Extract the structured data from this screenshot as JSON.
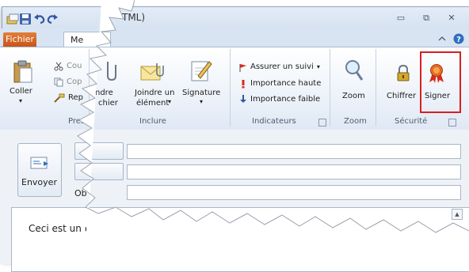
{
  "window": {
    "title_fragment": "TML)",
    "minimize_glyph": "▭",
    "restore_glyph": "⧉",
    "close_glyph": "✕"
  },
  "tabs": {
    "file": "Fichier",
    "active_fragment": "Me"
  },
  "ribbon": {
    "clipboard": {
      "paste": "Coller",
      "cut": "Cou",
      "copy": "Cop",
      "format_painter": "Rep",
      "group_fragment": "Press"
    },
    "include": {
      "attach_file_line1": "ndre",
      "attach_file_line2": "chier",
      "attach_item_line1": "Joindre un",
      "attach_item_line2": "élément",
      "signature": "Signature",
      "group": "Inclure"
    },
    "tags": {
      "follow_up": "Assurer un suivi",
      "high_importance": "Importance haute",
      "low_importance": "Importance faible",
      "group": "Indicateurs"
    },
    "zoom": {
      "zoom": "Zoom",
      "group": "Zoom"
    },
    "security": {
      "encrypt": "Chiffrer",
      "sign": "Signer",
      "group": "Sécurité"
    }
  },
  "compose": {
    "send": "Envoyer",
    "subject_fragment": "Ob",
    "body_fragment": "Ceci est un r"
  },
  "colors": {
    "accent_file_tab": "#d0601f",
    "highlight": "#d81f1f"
  }
}
